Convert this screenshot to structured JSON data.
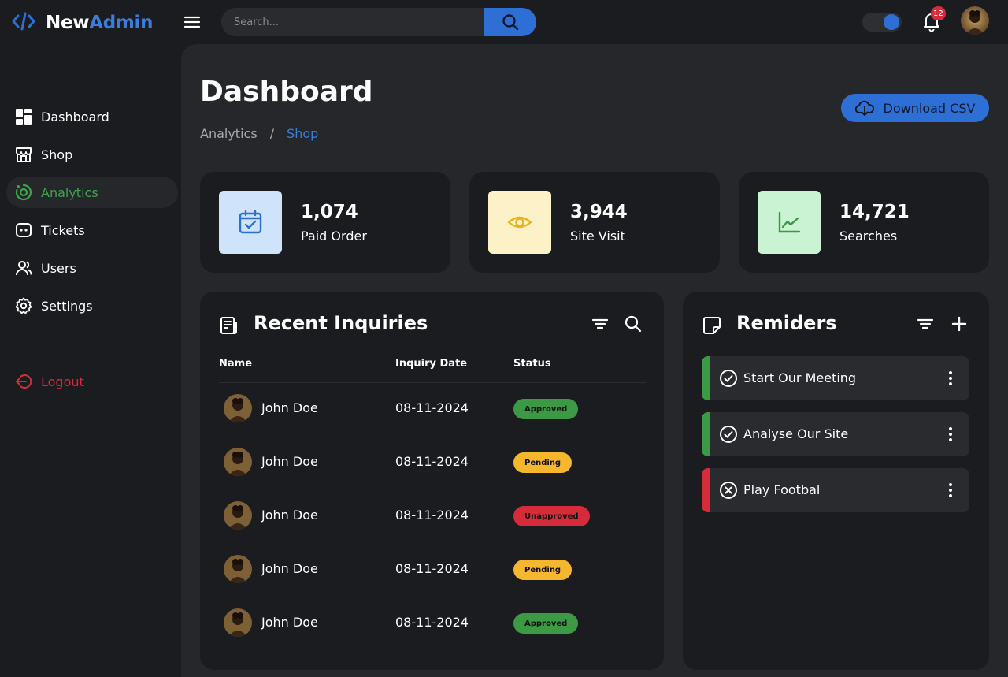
{
  "app": {
    "brand_part1": "New",
    "brand_part2": "Admin"
  },
  "topbar": {
    "search_placeholder": "Search...",
    "notification_count": "12"
  },
  "sidebar": {
    "items": [
      {
        "label": "Dashboard",
        "icon": "dashboard-icon"
      },
      {
        "label": "Shop",
        "icon": "store-icon"
      },
      {
        "label": "Analytics",
        "icon": "analytics-icon",
        "active": true
      },
      {
        "label": "Tickets",
        "icon": "ticket-icon"
      },
      {
        "label": "Users",
        "icon": "users-icon"
      },
      {
        "label": "Settings",
        "icon": "gear-icon"
      }
    ],
    "logout": "Logout"
  },
  "page": {
    "title": "Dashboard",
    "breadcrumb": [
      "Analytics",
      "/",
      "Shop"
    ],
    "download_label": "Download CSV"
  },
  "stats": [
    {
      "value": "1,074",
      "label": "Paid Order",
      "icon": "calendar-check-icon",
      "bg": "#cfe3fb",
      "fg": "#2e6fd6"
    },
    {
      "value": "3,944",
      "label": "Site Visit",
      "icon": "eye-icon",
      "bg": "#fdf1c7",
      "fg": "#e8b420"
    },
    {
      "value": "14,721",
      "label": "Searches",
      "icon": "trend-chart-icon",
      "bg": "#c9f3d3",
      "fg": "#3d9a44"
    }
  ],
  "inquiries": {
    "title": "Recent Inquiries",
    "columns": [
      "Name",
      "Inquiry Date",
      "Status"
    ],
    "rows": [
      {
        "name": "John Doe",
        "date": "08-11-2024",
        "status": "Approved",
        "type": "approved"
      },
      {
        "name": "John Doe",
        "date": "08-11-2024",
        "status": "Pending",
        "type": "pending"
      },
      {
        "name": "John Doe",
        "date": "08-11-2024",
        "status": "Unapproved",
        "type": "unapproved"
      },
      {
        "name": "John Doe",
        "date": "08-11-2024",
        "status": "Pending",
        "type": "pending"
      },
      {
        "name": "John Doe",
        "date": "08-11-2024",
        "status": "Approved",
        "type": "approved"
      }
    ]
  },
  "reminders": {
    "title": "Remiders",
    "items": [
      {
        "text": "Start Our Meeting",
        "state": "done",
        "color": "#3d9a44"
      },
      {
        "text": "Analyse Our Site",
        "state": "done",
        "color": "#3d9a44"
      },
      {
        "text": "Play Footbal",
        "state": "cancelled",
        "color": "#d62b3a"
      }
    ]
  },
  "colors": {
    "accent": "#2e6fd6",
    "success": "#3d9a44",
    "warning": "#f4b72d",
    "danger": "#d62b3a"
  }
}
